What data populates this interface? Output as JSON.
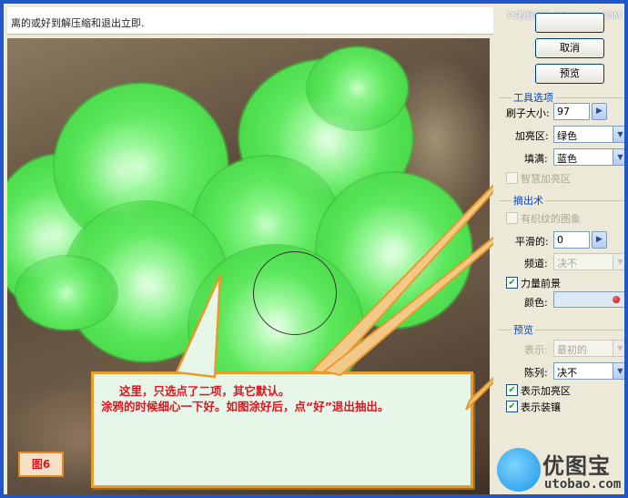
{
  "instruction": "离的或好到解压缩和退出立即.",
  "watermark_top": "PS教程论坛 BBS.16XX8.COM",
  "buttons": {
    "ok": "",
    "cancel": "取消",
    "preview": "预览"
  },
  "tool_options": {
    "title": "工具选项",
    "brush_size_label": "刷子大小:",
    "brush_size_value": "97",
    "highlight_label": "加亮区:",
    "highlight_value": "绿色",
    "fill_label": "填满:",
    "fill_value": "蓝色",
    "smart_highlight_label": "智慧加亮区"
  },
  "extraction": {
    "title": "摘出术",
    "textured_image_label": "有织纹的图象",
    "smooth_label": "平滑的:",
    "smooth_value": "0",
    "channel_label": "频道:",
    "channel_value": "决不",
    "force_foreground_label": "力量前景",
    "force_foreground_checked": true,
    "color_label": "颜色:",
    "color_value": "#c80000"
  },
  "preview_group": {
    "title": "预览",
    "show_label": "表示:",
    "show_value": "最初的",
    "display_label": "陈列:",
    "display_value": "决不",
    "show_highlight_label": "表示加亮区",
    "show_highlight_checked": true,
    "show_fill_label": "表示装镶",
    "show_fill_checked": true
  },
  "callout": {
    "line1": "这里，只选点了二项，其它默认。",
    "line2": "涂鸦的时候细心一下好。如图涂好后，点“好”退出抽出。"
  },
  "figure_label": "图6",
  "logo": {
    "cn": "优图宝",
    "en": "utobao.com"
  },
  "colors": {
    "accent": "#0046d5",
    "highlight_green": "#46d846",
    "callout_border": "#e89a2c",
    "callout_text": "#e0141e"
  }
}
